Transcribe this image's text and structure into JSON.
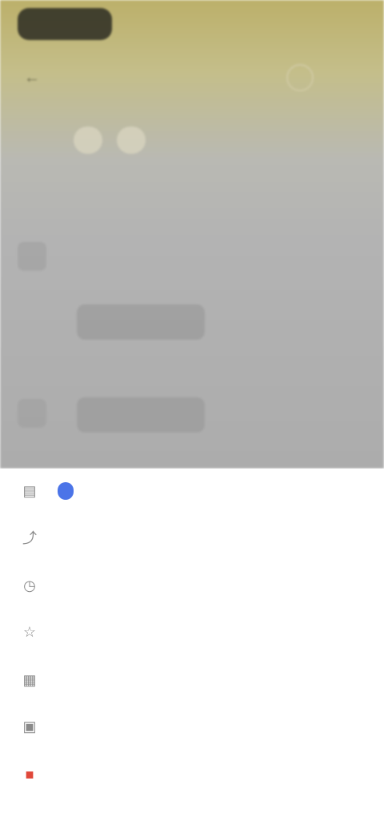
{
  "status_bar": {
    "time": "",
    "right": ""
  },
  "app_bar": {
    "title": ""
  },
  "filters": [
    {
      "label": ""
    },
    {
      "label": ""
    }
  ],
  "list": [
    {
      "title": "",
      "meta": ""
    },
    {
      "title": "",
      "meta": ""
    },
    {
      "title": "",
      "meta": ""
    }
  ],
  "sheet": {
    "items": [
      {
        "label": "",
        "icon": "doc-icon",
        "badge": ""
      },
      {
        "label": "",
        "icon": "pin-icon"
      },
      {
        "label": "",
        "icon": "clock-icon"
      },
      {
        "label": "",
        "icon": "star-icon"
      },
      {
        "label": "",
        "icon": "image-icon"
      },
      {
        "label": "",
        "icon": "folder-icon"
      },
      {
        "label": "",
        "icon": "trash-icon"
      }
    ]
  },
  "colors": {
    "accent": "#4b74e8",
    "danger": "#e0483a",
    "scrim_top": "#bcb06a"
  }
}
